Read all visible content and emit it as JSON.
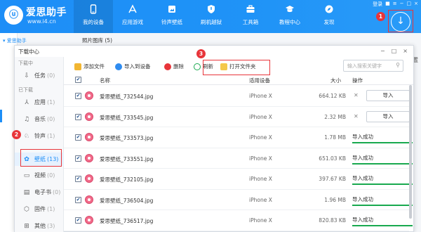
{
  "app": {
    "logo_mark": "ⓤ",
    "name": "爱思助手",
    "url": "www.i4.cn"
  },
  "nav": [
    {
      "label": "我的设备",
      "icon": "phone-icon",
      "active": true
    },
    {
      "label": "应用游戏",
      "icon": "apps-icon"
    },
    {
      "label": "铃声壁纸",
      "icon": "wallpaper-icon"
    },
    {
      "label": "刷机越狱",
      "icon": "shield-icon"
    },
    {
      "label": "工具箱",
      "icon": "toolbox-icon"
    },
    {
      "label": "教程中心",
      "icon": "graduation-cap-icon"
    },
    {
      "label": "发现",
      "icon": "compass-icon"
    }
  ],
  "window": {
    "login": "登录",
    "controls": [
      "■",
      "≡",
      "−",
      "□",
      "×"
    ]
  },
  "badges": {
    "b1": "1",
    "b2": "2",
    "b3": "3"
  },
  "under": {
    "sidebar_title": "▾ 爱思助手",
    "tab": "照片图库 (5)",
    "right_text": "置"
  },
  "dialog": {
    "title": "下载中心",
    "controls": [
      "−",
      "□",
      "×"
    ],
    "sidebar": {
      "downloading_header": "下载中",
      "downloaded_header": "已下载",
      "items": [
        {
          "label": "任务",
          "count": "(0)",
          "icon": "task-icon",
          "glyph": "⇩"
        },
        {
          "label": "应用",
          "count": "(1)",
          "icon": "app-icon",
          "glyph": "⅄"
        },
        {
          "label": "音乐",
          "count": "(0)",
          "icon": "music-icon",
          "glyph": "♫"
        },
        {
          "label": "铃声",
          "count": "(1)",
          "icon": "bell-icon",
          "glyph": "♘"
        },
        {
          "label": "壁纸",
          "count": "(13)",
          "icon": "flower-icon",
          "glyph": "✿",
          "active": true
        },
        {
          "label": "视频",
          "count": "(0)",
          "icon": "video-icon",
          "glyph": "▭"
        },
        {
          "label": "电子书",
          "count": "(0)",
          "icon": "book-icon",
          "glyph": "▤"
        },
        {
          "label": "固件",
          "count": "(1)",
          "icon": "firmware-icon",
          "glyph": "⬡"
        },
        {
          "label": "其他",
          "count": "(3)",
          "icon": "grid-icon",
          "glyph": "⊞"
        }
      ]
    },
    "toolbar": {
      "add_file": "添加文件",
      "import_device": "导入到设备",
      "delete": "删除",
      "refresh": "刷新",
      "open_folder": "打开文件夹",
      "search_placeholder": "输入搜索关键字"
    },
    "table": {
      "headers": {
        "name": "名称",
        "device": "适用设备",
        "size": "大小",
        "action": "操作"
      },
      "rows": [
        {
          "name": "爱思壁纸_732544.jpg",
          "device": "iPhone X",
          "size": "664.12 KB",
          "status": "pending",
          "action": "导入"
        },
        {
          "name": "爱思壁纸_733545.jpg",
          "device": "iPhone X",
          "size": "2.32 MB",
          "status": "pending",
          "action": "导入"
        },
        {
          "name": "爱思壁纸_733573.jpg",
          "device": "iPhone X",
          "size": "1.78 MB",
          "status": "done",
          "action": "导入成功"
        },
        {
          "name": "爱思壁纸_733551.jpg",
          "device": "iPhone X",
          "size": "651.03 KB",
          "status": "done",
          "action": "导入成功"
        },
        {
          "name": "爱思壁纸_732105.jpg",
          "device": "iPhone X",
          "size": "397.67 KB",
          "status": "done",
          "action": "导入成功"
        },
        {
          "name": "爱思壁纸_736504.jpg",
          "device": "iPhone X",
          "size": "1.96 MB",
          "status": "done",
          "action": "导入成功"
        },
        {
          "name": "爱思壁纸_736517.jpg",
          "device": "iPhone X",
          "size": "820.83 KB",
          "status": "done",
          "action": "导入成功"
        }
      ]
    }
  },
  "colors": {
    "accent": "#1d8ef7",
    "highlight": "#e8353a",
    "success": "#19a94f"
  }
}
